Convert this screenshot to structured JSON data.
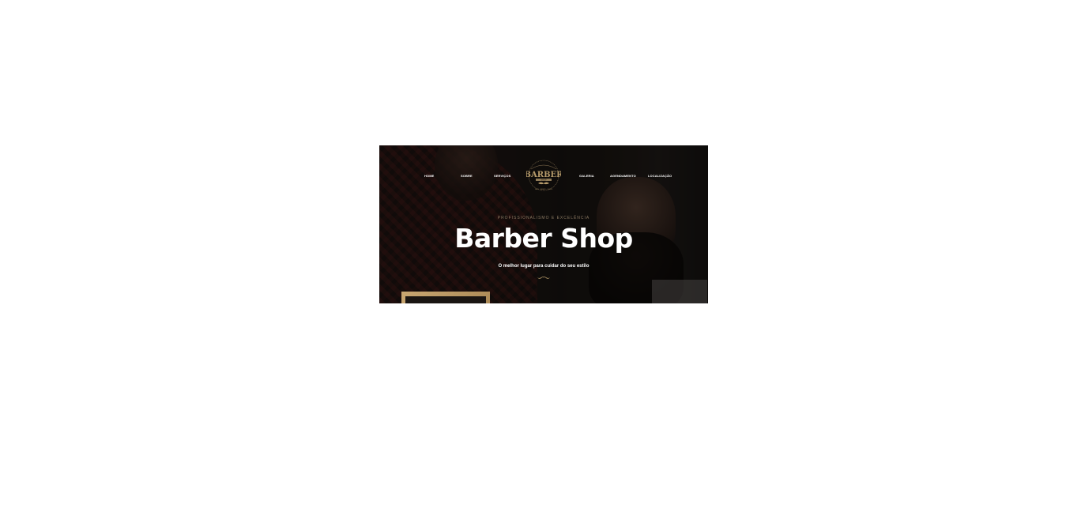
{
  "nav": {
    "items": [
      {
        "label": "HOME"
      },
      {
        "label": "SOBRE"
      },
      {
        "label": "SERVIÇOS"
      },
      {
        "label": "GALERIA"
      },
      {
        "label": "AGENDAMENTO"
      },
      {
        "label": "LOCALIZAÇÃO"
      }
    ]
  },
  "logo": {
    "text": "BARBER",
    "subtext": "SHOP",
    "ring_text": "HAIR · BEARD · SHAVE"
  },
  "hero": {
    "subtitle": "PROFISSIONALISMO E EXCELÊNCIA",
    "title": "Barber Shop",
    "tagline": "O melhor lugar para cuidar do seu estilo"
  },
  "colors": {
    "accent": "#b59a6a",
    "subtitle": "#8b7a63",
    "text": "#ffffff",
    "frame": "#c9a772"
  }
}
